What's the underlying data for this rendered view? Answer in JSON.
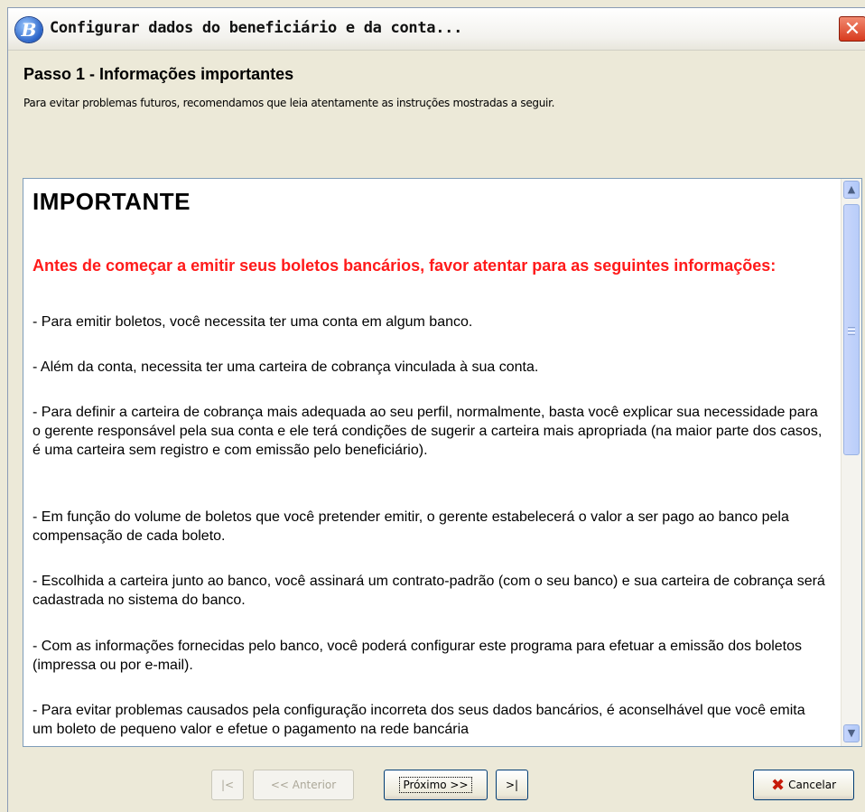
{
  "window": {
    "app_icon_letter": "B",
    "title": "Configurar dados do beneficiário e da conta...",
    "close_glyph": "✕"
  },
  "header": {
    "step_title": "Passo 1 - Informações importantes",
    "step_subtitle": "Para evitar problemas futuros, recomendamos que leia atentamente as instruções mostradas a seguir."
  },
  "content": {
    "heading": "IMPORTANTE",
    "warning": "Antes de começar a emitir seus boletos bancários, favor atentar para as seguintes informações:",
    "paragraphs": [
      "- Para emitir boletos, você necessita ter uma conta em algum banco.",
      "- Além da conta, necessita ter uma carteira de cobrança vinculada à sua conta.",
      "- Para definir a carteira de cobrança mais adequada ao seu perfil, normalmente, basta você explicar sua necessidade para o gerente responsável pela sua conta e ele terá condições de sugerir a carteira mais apropriada (na maior parte dos casos, é uma carteira sem registro e com emissão pelo beneficiário).",
      "- Em função do volume de boletos que você pretender emitir, o gerente estabelecerá o valor a ser pago ao banco pela compensação de cada boleto.",
      "- Escolhida a carteira junto ao banco, você assinará um contrato-padrão (com o seu banco) e sua carteira de cobrança será cadastrada no sistema do banco.",
      "- Com as informações fornecidas pelo banco, você poderá configurar este programa para efetuar a emissão dos boletos (impressa ou por e-mail).",
      "- Para evitar problemas causados pela configuração incorreta dos seus dados bancários, é aconselhável que você emita um boleto de pequeno valor e efetue o pagamento na rede bancária"
    ]
  },
  "scrollbar": {
    "up_icon": "up-arrow-icon",
    "down_icon": "down-arrow-icon"
  },
  "buttons": {
    "first": "|<",
    "previous": "<< Anterior",
    "next": "Próximo >>",
    "last": ">|",
    "cancel": "Cancelar"
  }
}
